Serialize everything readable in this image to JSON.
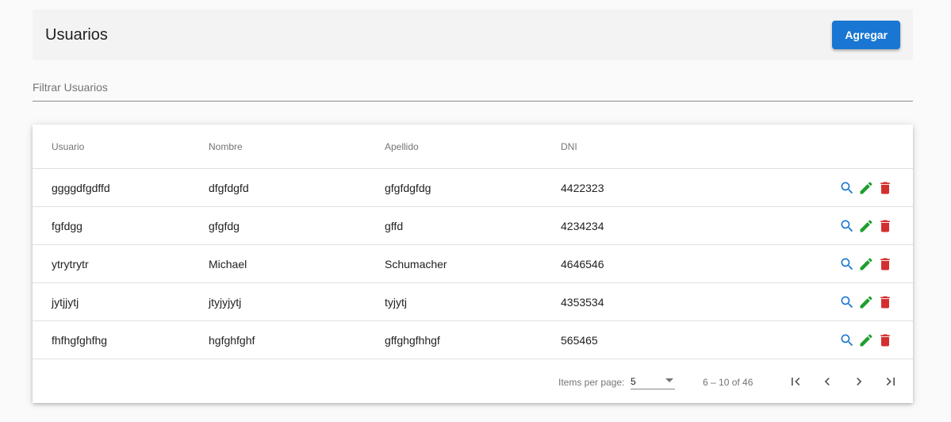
{
  "header": {
    "title": "Usuarios",
    "add_label": "Agregar"
  },
  "filter": {
    "placeholder": "Filtrar Usuarios"
  },
  "table": {
    "columns": [
      "Usuario",
      "Nombre",
      "Apellido",
      "DNI"
    ],
    "rows": [
      [
        "ggggdfgdffd",
        "dfgfdgfd",
        "gfgfdgfdg",
        "4422323"
      ],
      [
        "fgfdgg",
        "gfgfdg",
        "gffd",
        "4234234"
      ],
      [
        "ytrytrytr",
        "Michael",
        "Schumacher",
        "4646546"
      ],
      [
        "jytjjytj",
        "jtyjyjytj",
        "tyjytj",
        "4353534"
      ],
      [
        "fhfhgfghfhg",
        "hgfghfghf",
        "gffghgfhhgf",
        "565465"
      ]
    ],
    "row_actions": [
      "search-icon",
      "edit-pencil-icon",
      "delete-trash-icon"
    ]
  },
  "paginator": {
    "items_per_page_label": "Items per page:",
    "items_per_page_value": "5",
    "range_label": "6 – 10 of 46"
  },
  "colors": {
    "primary": "#1976d2",
    "view": "#1976d2",
    "edit": "#1e9e2e",
    "delete": "#d32f2f",
    "header_bg": "#f3f3f3"
  }
}
